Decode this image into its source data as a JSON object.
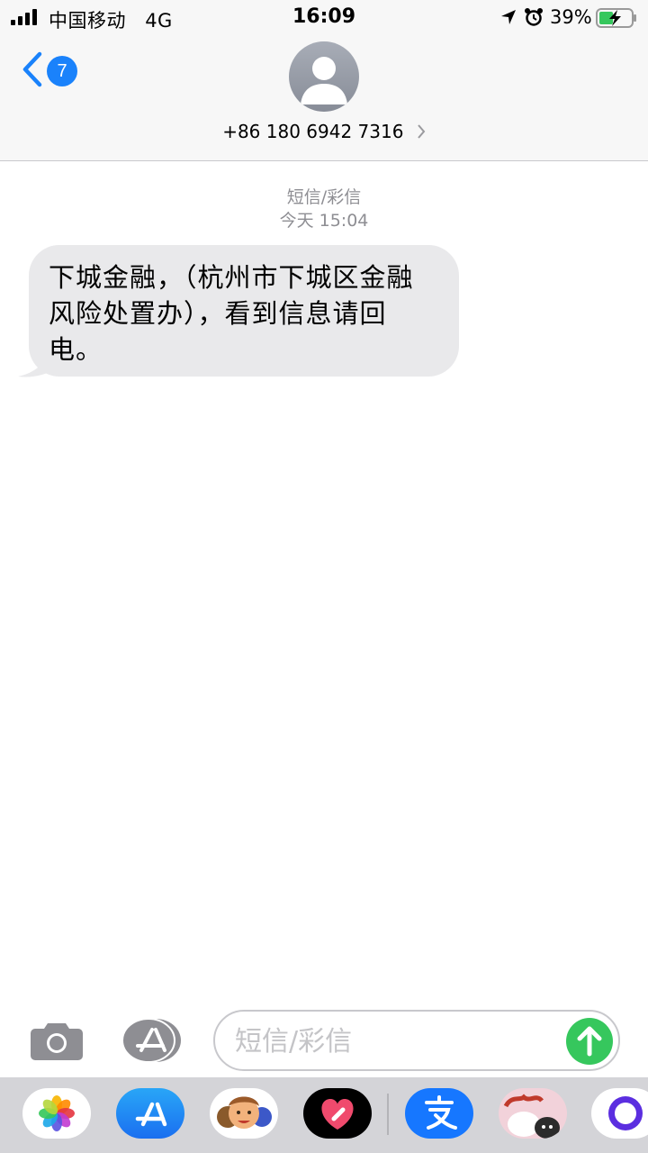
{
  "status_bar": {
    "carrier": "中国移动",
    "network": "4G",
    "time": "16:09",
    "battery_percent": "39%",
    "icons": [
      "signal-bars-icon",
      "location-arrow-icon",
      "alarm-clock-icon",
      "battery-charging-icon"
    ]
  },
  "nav": {
    "unread_count": "7",
    "contact_name": "+86 180 6942 7316"
  },
  "thread": {
    "message_type": "短信/彩信",
    "timestamp": "今天 15:04",
    "messages": [
      {
        "direction": "incoming",
        "text": "下城金融，（杭州市下城区金融风险处置办），看到信息请回电。"
      }
    ]
  },
  "composer": {
    "placeholder": "短信/彩信"
  },
  "app_drawer": {
    "apps": [
      "photos",
      "app-store",
      "memoji",
      "digital-touch",
      "alipay",
      "stickers",
      "extra-app"
    ]
  },
  "colors": {
    "accent_blue": "#1a82fb",
    "send_green": "#36c75d",
    "bubble_gray": "#e9e9eb",
    "meta_gray": "#8e8e93"
  }
}
